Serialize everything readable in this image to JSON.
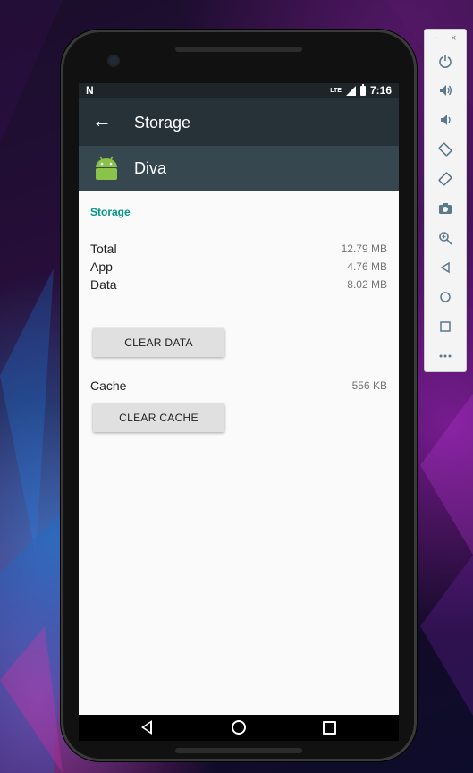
{
  "status_bar": {
    "carrier_icon": "N",
    "network": "LTE",
    "time": "7:16"
  },
  "app_bar": {
    "title": "Storage",
    "back_icon": "arrow-back"
  },
  "app_header": {
    "name": "Diva",
    "icon": "android-robot"
  },
  "storage": {
    "section_title": "Storage",
    "rows": [
      {
        "label": "Total",
        "value": "12.79 MB"
      },
      {
        "label": "App",
        "value": "4.76 MB"
      },
      {
        "label": "Data",
        "value": "8.02 MB"
      }
    ],
    "clear_data_label": "CLEAR DATA",
    "cache_label": "Cache",
    "cache_value": "556 KB",
    "clear_cache_label": "CLEAR CACHE"
  },
  "nav_bar": {
    "buttons": [
      "back",
      "home",
      "recents"
    ]
  },
  "toolbar": {
    "window_controls": {
      "minimize": "–",
      "close": "×"
    },
    "items": [
      "power",
      "volume-up",
      "volume-down",
      "rotate-left",
      "rotate-right",
      "screenshot",
      "zoom",
      "back",
      "home",
      "overview",
      "more"
    ]
  },
  "colors": {
    "app_bar": "#263238",
    "app_header": "#37474f",
    "accent": "#009688",
    "android_green": "#8bc34a",
    "toolbar_icon": "#5a7a8c"
  }
}
